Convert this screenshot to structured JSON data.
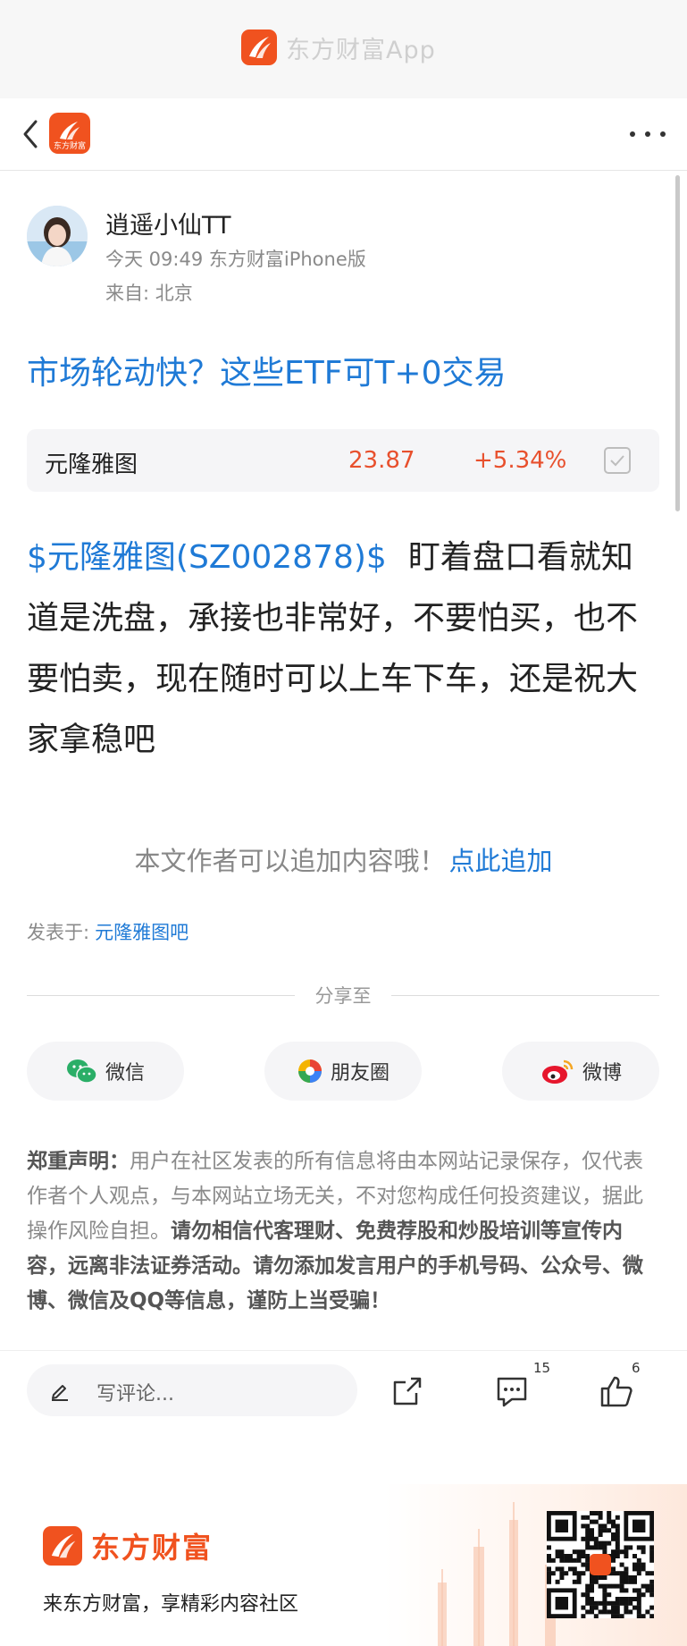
{
  "app_header": {
    "title": "东方财富App"
  },
  "nav": {
    "logo_text": "东方财富"
  },
  "author": {
    "name": "逍遥小仙TT",
    "meta": "今天 09:49 东方财富iPhone版",
    "location": "来自: 北京"
  },
  "post": {
    "title": "市场轮动快？这些ETF可T+0交易",
    "body_link": "$元隆雅图(SZ002878)$",
    "body_text": "盯着盘口看就知道是洗盘，承接也非常好，不要怕买，也不要怕卖，现在随时可以上车下车，还是祝大家拿稳吧"
  },
  "stock_card": {
    "name": "元隆雅图",
    "price": "23.87",
    "change": "+5.34%"
  },
  "append": {
    "text": "本文作者可以追加内容哦！",
    "link": "点此追加"
  },
  "posted_in": {
    "label": "发表于:",
    "bar": "元隆雅图吧"
  },
  "share": {
    "label": "分享至",
    "buttons": [
      {
        "label": "微信",
        "icon": "wechat-icon"
      },
      {
        "label": "朋友圈",
        "icon": "moments-icon"
      },
      {
        "label": "微博",
        "icon": "weibo-icon"
      }
    ]
  },
  "disclaimer": {
    "title": "郑重声明：",
    "normal": "用户在社区发表的所有信息将由本网站记录保存，仅代表作者个人观点，与本网站立场无关，不对您构成任何投资建议，据此操作风险自担。",
    "strong": "请勿相信代客理财、免费荐股和炒股培训等宣传内容，远离非法证券活动。请勿添加发言用户的手机号码、公众号、微博、微信及QQ等信息，谨防上当受骗！"
  },
  "comment_bar": {
    "placeholder": "写评论...",
    "comment_count": "15",
    "like_count": "6"
  },
  "footer": {
    "brand": "东方财富",
    "slogan": "来东方财富，享精彩内容社区"
  },
  "colors": {
    "brand": "#f0521f",
    "link": "#1f7ad6",
    "rise": "#e8502d"
  }
}
